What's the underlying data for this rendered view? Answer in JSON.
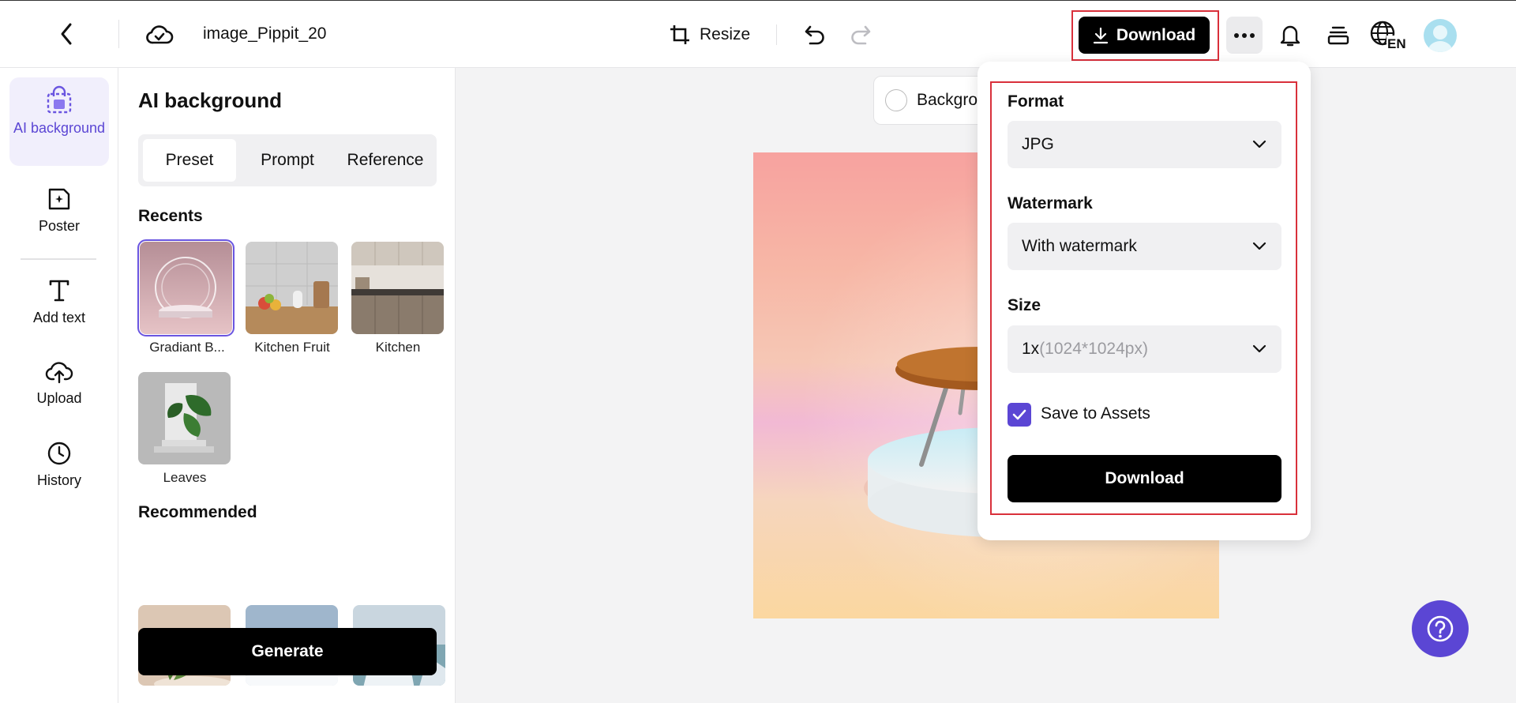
{
  "header": {
    "filename": "image_Pippit_20",
    "resize_label": "Resize",
    "download_label": "Download",
    "lang_label": "EN"
  },
  "rail": {
    "items": [
      {
        "label": "AI background",
        "icon": "bag-icon",
        "active": true
      },
      {
        "label": "Poster",
        "icon": "poster-icon"
      },
      {
        "label": "Add text",
        "icon": "text-icon"
      },
      {
        "label": "Upload",
        "icon": "upload-cloud-icon"
      },
      {
        "label": "History",
        "icon": "clock-icon"
      }
    ]
  },
  "panel": {
    "title": "AI background",
    "tabs": [
      "Preset",
      "Prompt",
      "Reference"
    ],
    "recents_heading": "Recents",
    "recents": [
      "Gradiant B...",
      "Kitchen Fruit",
      "Kitchen",
      "Leaves"
    ],
    "recommended_heading": "Recommended",
    "generate_label": "Generate"
  },
  "canvas": {
    "chip_label": "Background"
  },
  "download_menu": {
    "format_label": "Format",
    "format_value": "JPG",
    "watermark_label": "Watermark",
    "watermark_value": "With watermark",
    "size_label": "Size",
    "size_value": "1x",
    "size_hint": "(1024*1024px)",
    "save_label": "Save to Assets",
    "save_checked": true,
    "download_label": "Download"
  },
  "colors": {
    "accent": "#5b46d4",
    "highlight": "#d9303b"
  }
}
